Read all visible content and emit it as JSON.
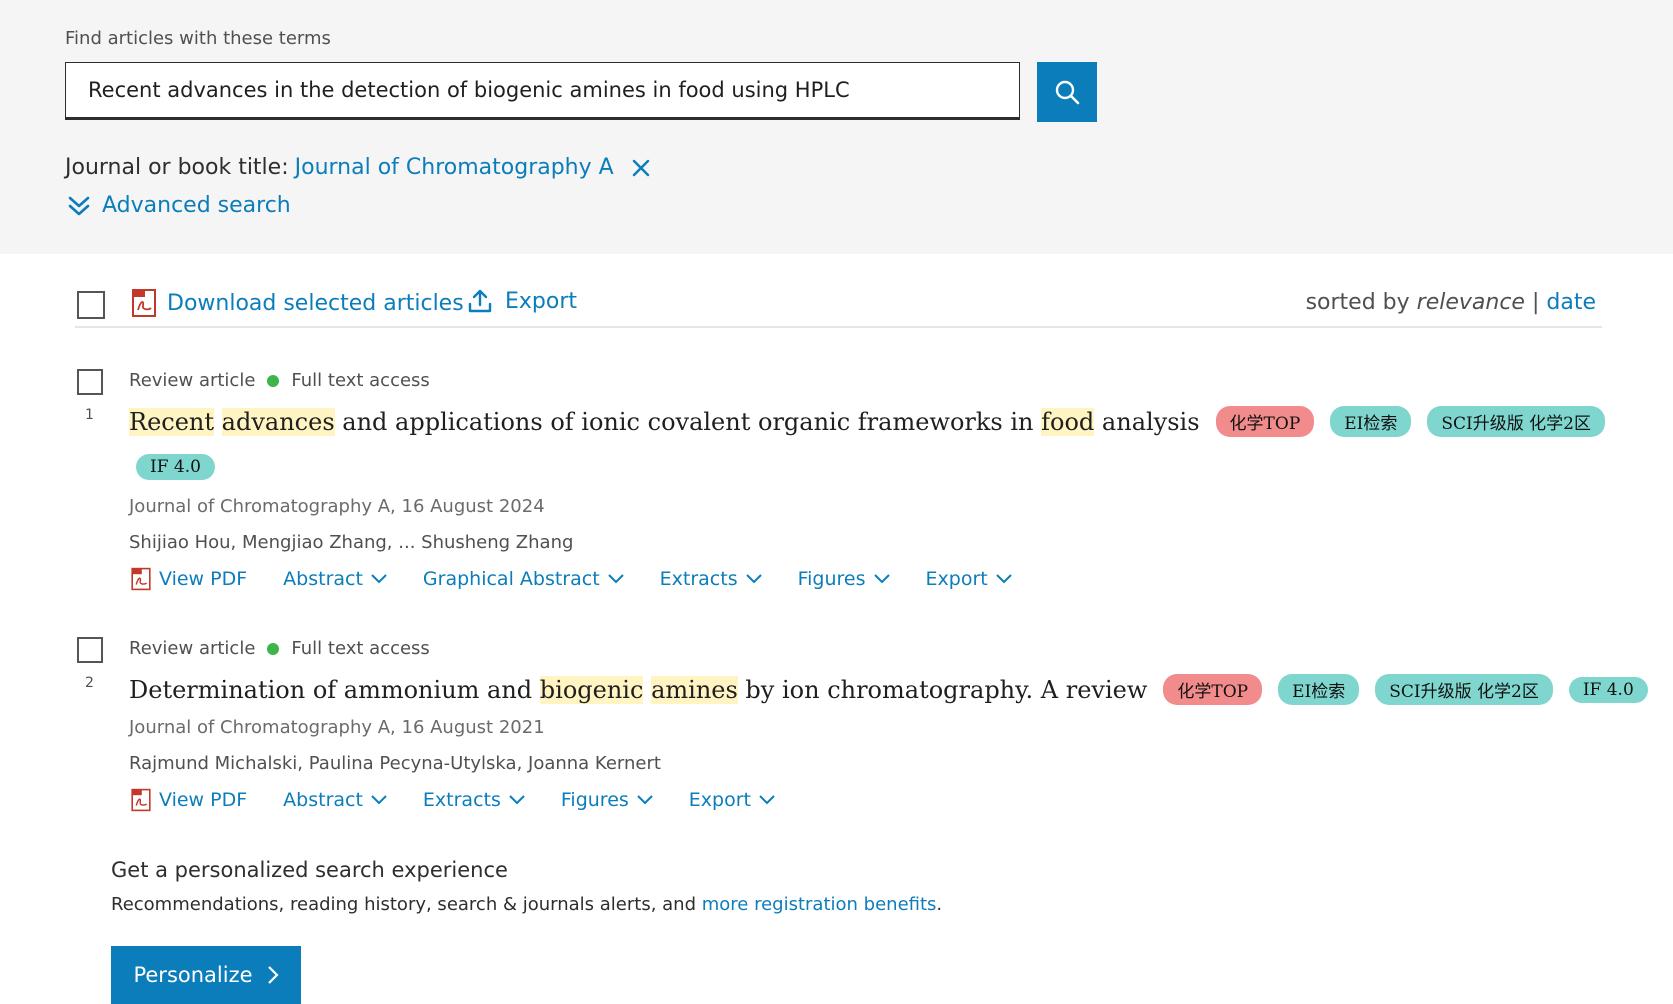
{
  "search": {
    "label": "Find articles with these terms",
    "value": "Recent advances in the detection of biogenic amines in food using HPLC",
    "button_icon": "search-icon"
  },
  "filter": {
    "label": "Journal or book title:",
    "value": "Journal of Chromatography A",
    "remove_icon": "close-icon"
  },
  "advanced": {
    "label": "Advanced search",
    "icon": "double-chevron-down-icon"
  },
  "toolbar": {
    "download_label": "Download selected articles",
    "export_label": "Export",
    "sort_prefix": "sorted by",
    "sort_relevance": "relevance",
    "sort_sep": "|",
    "sort_date": "date"
  },
  "results": [
    {
      "number": "1",
      "type": "Review article",
      "access": "Full text access",
      "title_parts": [
        {
          "text": "Recent",
          "hl": true
        },
        {
          "text": " ",
          "hl": false
        },
        {
          "text": "advances",
          "hl": true
        },
        {
          "text": " and applications of ionic covalent organic frameworks in ",
          "hl": false
        },
        {
          "text": "food",
          "hl": true
        },
        {
          "text": " analysis",
          "hl": false
        }
      ],
      "badges": [
        "化学TOP",
        "EI检索",
        "SCI升级版 化学2区",
        "IF 4.0"
      ],
      "journal": "Journal of Chromatography A, 16 August 2024",
      "authors": "Shijiao Hou, Mengjiao Zhang, ... Shusheng Zhang",
      "actions": [
        "View PDF",
        "Abstract",
        "Graphical Abstract",
        "Extracts",
        "Figures",
        "Export"
      ]
    },
    {
      "number": "2",
      "type": "Review article",
      "access": "Full text access",
      "title_parts": [
        {
          "text": "Determination of ammonium and ",
          "hl": false
        },
        {
          "text": "biogenic",
          "hl": true
        },
        {
          "text": " ",
          "hl": false
        },
        {
          "text": "amines",
          "hl": true
        },
        {
          "text": " by ion chromatography. A review",
          "hl": false
        }
      ],
      "badges": [
        "化学TOP",
        "EI检索",
        "SCI升级版 化学2区",
        "IF 4.0"
      ],
      "journal": "Journal of Chromatography A, 16 August 2021",
      "authors": "Rajmund Michalski, Paulina Pecyna-Utylska, Joanna Kernert",
      "actions": [
        "View PDF",
        "Abstract",
        "Extracts",
        "Figures",
        "Export"
      ]
    }
  ],
  "promo": {
    "title": "Get a personalized search experience",
    "text_before": "Recommendations, reading history, search & journals alerts, and ",
    "link": "more registration benefits",
    "text_after": ".",
    "button": "Personalize"
  },
  "colors": {
    "link": "#0c7dbb",
    "access_dot": "#3db54a",
    "badge_red": "#f28b8b",
    "badge_teal": "#7fd6cf",
    "highlight": "#fff4c2"
  }
}
